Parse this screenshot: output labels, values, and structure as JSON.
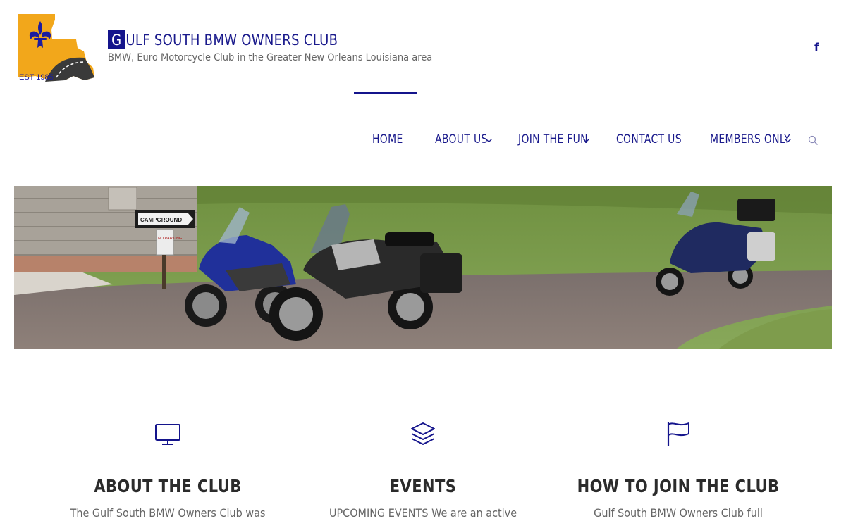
{
  "header": {
    "logo_text": "EST 1985",
    "title_first_letter": "G",
    "title_rest": "ULF SOUTH BMW OWNERS CLUB",
    "tagline": "BMW, Euro Motorcycle Club in the Greater New Orleans Louisiana area",
    "social_facebook": "f"
  },
  "nav": {
    "items": [
      {
        "label": "HOME",
        "has_dropdown": false,
        "active": true
      },
      {
        "label": "ABOUT US",
        "has_dropdown": true
      },
      {
        "label": "JOIN THE FUN",
        "has_dropdown": true
      },
      {
        "label": "CONTACT US",
        "has_dropdown": false
      },
      {
        "label": "MEMBERS ONLY",
        "has_dropdown": true
      }
    ],
    "search_icon": "search-icon"
  },
  "hero": {
    "sign_campground": "CAMPGROUND",
    "sign_no_parking": "NO PARKING"
  },
  "features": [
    {
      "icon": "monitor-icon",
      "title": "ABOUT THE CLUB",
      "text": "The Gulf South BMW Owners Club was"
    },
    {
      "icon": "layers-icon",
      "title": "EVENTS",
      "text": "UPCOMING EVENTS We are an active"
    },
    {
      "icon": "flag-icon",
      "title": "HOW TO JOIN THE CLUB",
      "text": "Gulf South BMW Owners Club full"
    }
  ],
  "colors": {
    "brand_blue": "#14148c",
    "logo_gold": "#f2a71b",
    "heading": "#2b2b2b"
  }
}
